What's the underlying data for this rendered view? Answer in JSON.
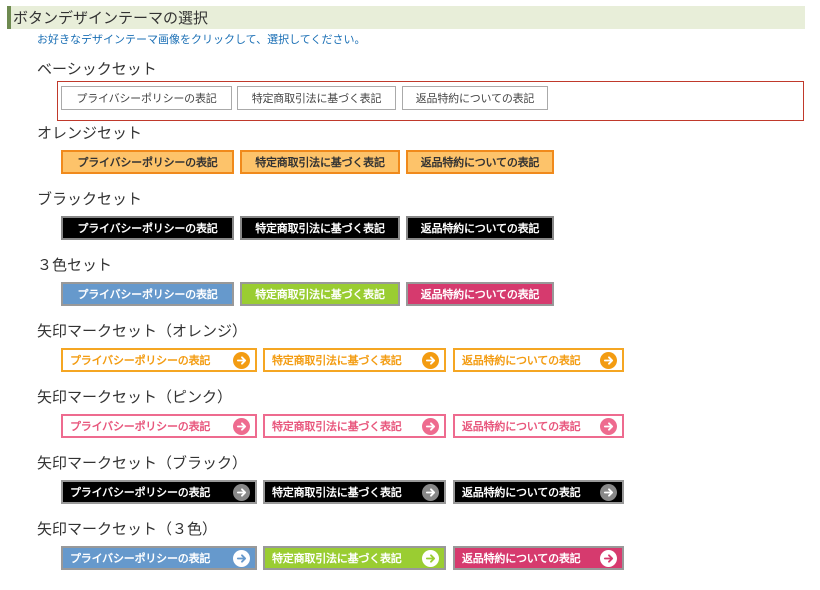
{
  "header": {
    "title": "ボタンデザインテーマの選択",
    "instruction": "お好きなデザインテーマ画像をクリックして、選択してください。"
  },
  "buttons": {
    "privacy": "プライバシーポリシーの表記",
    "tokutei": "特定商取引法に基づく表記",
    "henpin": "返品特約についての表記"
  },
  "sets": [
    {
      "id": "basic",
      "title": "ベーシックセット",
      "selected": true
    },
    {
      "id": "orange",
      "title": "オレンジセット"
    },
    {
      "id": "black",
      "title": "ブラックセット"
    },
    {
      "id": "three-color",
      "title": "３色セット"
    },
    {
      "id": "arrow-orange",
      "title": "矢印マークセット（オレンジ）"
    },
    {
      "id": "arrow-pink",
      "title": "矢印マークセット（ピンク）"
    },
    {
      "id": "arrow-black",
      "title": "矢印マークセット（ブラック）"
    },
    {
      "id": "arrow-three-color",
      "title": "矢印マークセット（３色）"
    }
  ],
  "colors": {
    "header_bg": "#e8eed9",
    "header_accent": "#6e8a50",
    "instruction_text": "#1a6fb5",
    "selected_frame": "#c0392b",
    "orange_fill": "#fdc36a",
    "orange_border": "#f08a1c",
    "blue": "#6699cc",
    "green": "#9acd32",
    "crimson": "#d63a6e",
    "pink": "#ee6b8f"
  },
  "icons": {
    "arrow": "arrow-right-circle-icon"
  }
}
